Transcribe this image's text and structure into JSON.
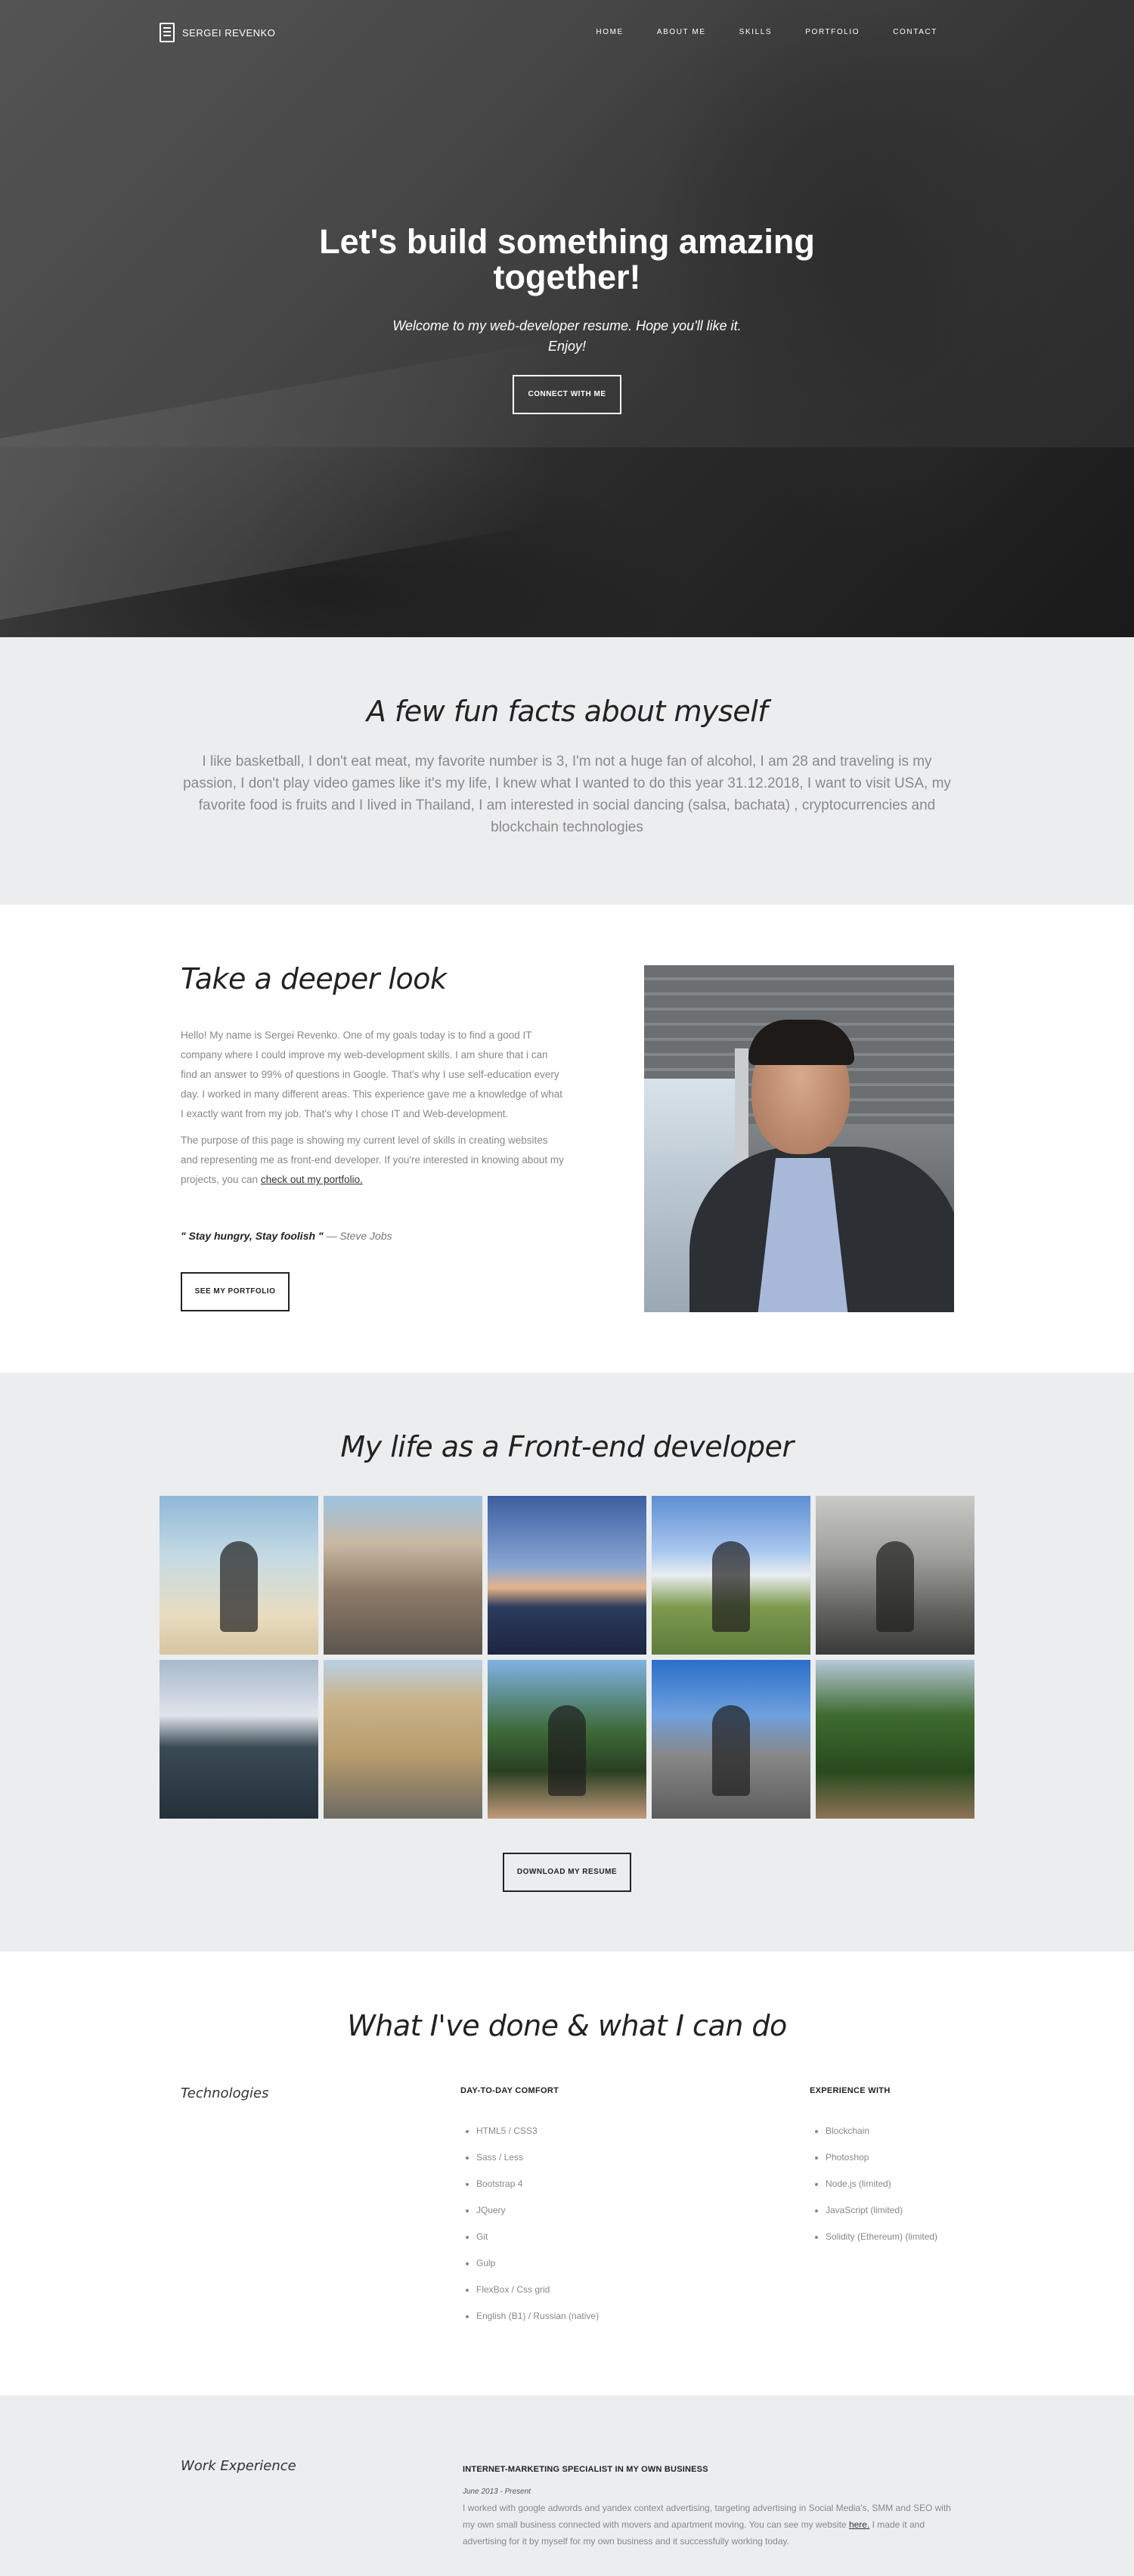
{
  "nav": {
    "brand": "SERGEI REVENKO",
    "links": [
      "HOME",
      "ABOUT ME",
      "SKILLS",
      "PORTFOLIO",
      "CONTACT"
    ]
  },
  "hero": {
    "title": "Let's build something amazing together!",
    "subtitle": "Welcome to my web-developer resume. Hope you'll like it. Enjoy!",
    "cta": "CONNECT WITH ME"
  },
  "facts": {
    "title": "A few fun facts about myself",
    "text": "I like basketball, I don't eat meat, my favorite number is 3, I'm not a huge fan of alcohol, I am 28 and traveling is my passion, I don't play video games like it's my life, I knew what I wanted to do this year 31.12.2018, I want to visit USA, my favorite food is fruits and I lived in Thailand, I am interested in social dancing (salsa, bachata) , cryptocurrencies and blockchain technologies"
  },
  "deeper": {
    "title": "Take a deeper look",
    "p1": "Hello! My name is Sergei Revenko. One of my goals today is to find a good IT company where I could improve my web-development skills. I am shure that i can find an answer to 99% of questions in Google. That's why I use self-education every day. I worked in many different areas. This experience gave me a knowledge of what I exactly want from my job. That's why I chose IT and Web-development.",
    "p2": "The purpose of this page is showing my current level of skills in creating websites and representing me as front-end developer. If you're interested in knowing about my projects, you can",
    "p2_link": "check out my portfolio.",
    "quote": "\" Stay hungry, Stay foolish \"",
    "quote_author": "— Steve Jobs",
    "button": "SEE MY PORTFOLIO"
  },
  "gallery": {
    "title": "My life as a Front-end developer",
    "button": "DOWNLOAD MY RESUME"
  },
  "skills": {
    "title": "What I've done & what I can do",
    "label": "Technologies",
    "comfort_heading": "DAY-TO-DAY COMFORT",
    "comfort": [
      "HTML5 / CSS3",
      "Sass / Less",
      "Bootstrap 4",
      "JQuery",
      "Git",
      "Gulp",
      "FlexBox / Css grid",
      "English (B1) / Russian (native)"
    ],
    "experience_heading": "EXPERIENCE WITH",
    "experience": [
      "Blockchain",
      "Photoshop",
      "Node.js (limited)",
      "JavaScript (limited)",
      "Solidity (Ethereum) (limited)"
    ]
  },
  "work": {
    "label": "Work Experience",
    "job_title": "INTERNET-MARKETING SPECIALIST IN MY OWN BUSINESS",
    "job_date": "June 2013 - Present",
    "job_desc": "I worked with google adwords and yandex context advertising, targeting advertising in Social Media's, SMM and SEO with my own small business connected with movers and apartment moving. You can see my website",
    "job_link": "here.",
    "job_desc_end": "I made it and advertising for it by myself for my own business and it successfully working today."
  }
}
